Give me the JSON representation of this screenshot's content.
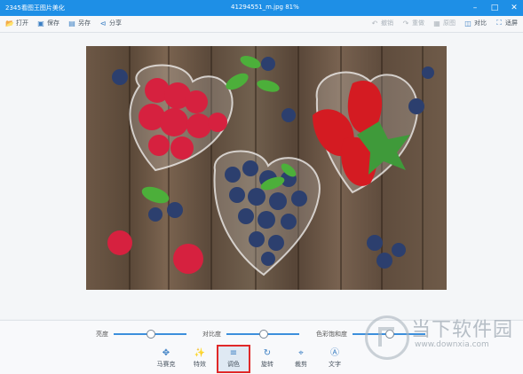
{
  "window": {
    "app_title": "2345看图王图片美化",
    "file_title": "41294551_m.jpg  81%"
  },
  "toolbar": {
    "left": [
      {
        "label": "打开",
        "icon": "folder-open-icon"
      },
      {
        "label": "保存",
        "icon": "save-icon"
      },
      {
        "label": "另存",
        "icon": "save-as-icon"
      },
      {
        "label": "分享",
        "icon": "share-icon"
      }
    ],
    "right": [
      {
        "label": "撤销",
        "icon": "undo-icon",
        "enabled": false
      },
      {
        "label": "重做",
        "icon": "redo-icon",
        "enabled": false
      },
      {
        "label": "原图",
        "icon": "original-image-icon",
        "enabled": false
      },
      {
        "label": "对比",
        "icon": "compare-icon",
        "enabled": true
      },
      {
        "label": "适屏",
        "icon": "fit-screen-icon",
        "enabled": true
      }
    ]
  },
  "sliders": [
    {
      "label": "亮度",
      "value": 0.5
    },
    {
      "label": "对比度",
      "value": 0.5
    },
    {
      "label": "色彩饱和度",
      "value": 0.5
    }
  ],
  "tools": [
    {
      "label": "马赛克",
      "icon": "mosaic-icon",
      "active": false
    },
    {
      "label": "特效",
      "icon": "effects-wand-icon",
      "active": false
    },
    {
      "label": "调色",
      "icon": "adjust-sliders-icon",
      "active": true
    },
    {
      "label": "旋转",
      "icon": "rotate-icon",
      "active": false
    },
    {
      "label": "裁剪",
      "icon": "crop-icon",
      "active": false
    },
    {
      "label": "文字",
      "icon": "text-icon",
      "active": false
    }
  ],
  "watermark": {
    "text": "当下软件园",
    "url": "www.downxia.com"
  }
}
